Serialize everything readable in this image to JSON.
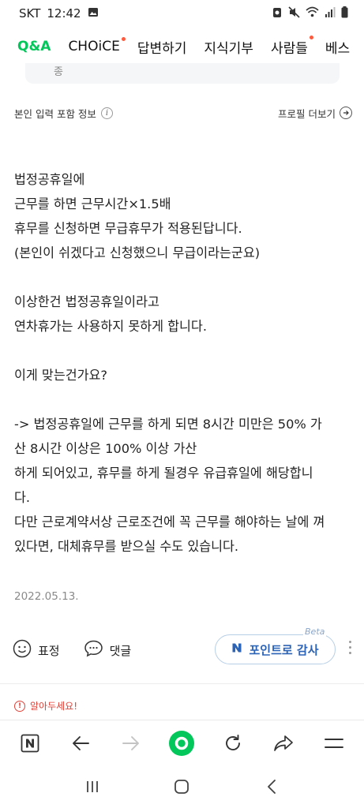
{
  "status_bar": {
    "carrier": "SKT",
    "time": "12:42"
  },
  "tabs": [
    {
      "label": "Q&A",
      "active": true,
      "dot": false
    },
    {
      "label": "CHOiCE",
      "active": false,
      "dot": true
    },
    {
      "label": "답변하기",
      "active": false,
      "dot": false
    },
    {
      "label": "지식기부",
      "active": false,
      "dot": false
    },
    {
      "label": "사람들",
      "active": false,
      "dot": true
    },
    {
      "label": "베스",
      "active": false,
      "dot": false
    }
  ],
  "card_remnant_text": "종",
  "info": {
    "label": "본인 입력 포함 정보",
    "profile_link": "프로필 더보기"
  },
  "answer": {
    "paragraphs": [
      "법정공휴일에\n근무를 하면 근무시간×1.5배\n휴무를 신청하면 무급휴무가 적용된답니다.\n(본인이 쉬겠다고 신청했으니 무급이라는군요)",
      "이상한건 법정공휴일이라고\n연차휴가는 사용하지 못하게 합니다.",
      "이게 맞는건가요?",
      "-> 법정공휴일에 근무를 하게 되면 8시간 미만은 50% 가\n산 8시간 이상은 100% 이상 가산\n하게 되어있고, 휴무를 하게 될경우 유급휴일에 해당합니\n다.\n다만 근로계약서상 근로조건에 꼭 근무를 해야하는 날에 껴\n있다면, 대체휴무를 받으실 수도 있습니다."
    ]
  },
  "date": "2022.05.13.",
  "actions": {
    "emotion_label": "표정",
    "comment_label": "댓글",
    "point_label": "포인트로 감사",
    "beta_label": "Beta"
  },
  "notice": "알아두세요!",
  "colors": {
    "accent_green": "#03c75a",
    "point_blue": "#2b63b6",
    "notice_red": "#e0443a"
  }
}
